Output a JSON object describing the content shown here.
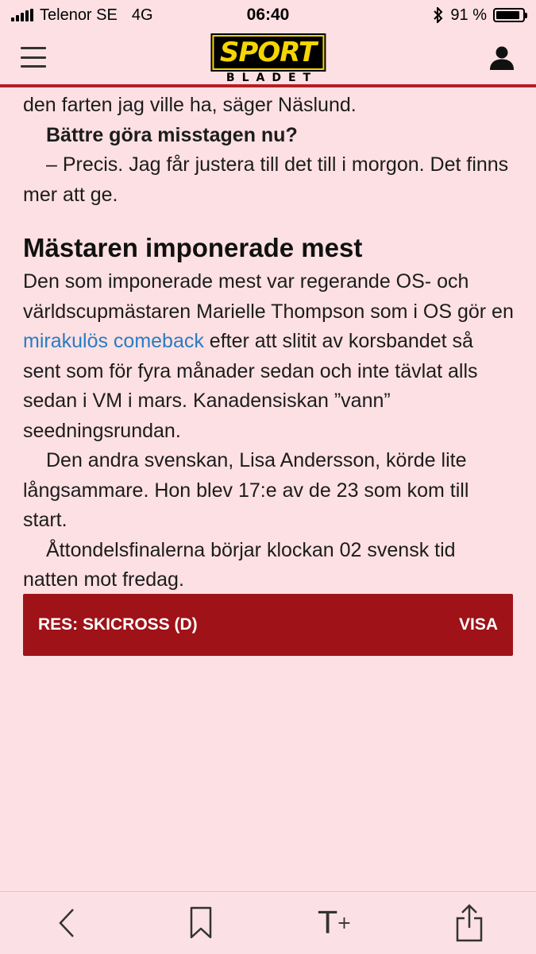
{
  "status_bar": {
    "carrier": "Telenor SE",
    "network": "4G",
    "time": "06:40",
    "battery_percent": "91 %",
    "battery_level": 0.91
  },
  "header": {
    "logo_top": "SPORT",
    "logo_bottom": "BLADET",
    "menu_icon": "hamburger-menu-icon",
    "user_icon": "user-icon"
  },
  "article": {
    "p1": "den farten jag ville ha, säger Näslund.",
    "q1": "Bättre göra misstagen nu?",
    "p2": "– Precis. Jag får justera till det till i morgon. Det finns mer att ge.",
    "subheading": "Mästaren imponerade mest",
    "p3_before": "Den som imponerade mest var regerande OS- och världscupmästaren Marielle Thompson som i OS gör en ",
    "p3_link": "mirakulös comeback",
    "p3_after": " efter att slitit av korsbandet så sent som för fyra månader sedan och inte tävlat alls sedan i VM i mars. Kanadensiskan ”vann” seedningsrundan.",
    "p4": "Den andra svenskan, Lisa Andersson, körde lite långsammare. Hon blev 17:e av de 23 som kom till start.",
    "p5": "Åttondelsfinalerna börjar klockan 02 svensk tid natten mot fredag."
  },
  "result_box": {
    "title": "RES: SKICROSS (D)",
    "action": "VISA"
  },
  "toolbar": {
    "text_size_label": "T",
    "text_size_plus": "+"
  },
  "colors": {
    "background": "#fde0e3",
    "accent_red": "#b51e24",
    "result_red": "#9e1218",
    "link_blue": "#2a7cc0"
  }
}
